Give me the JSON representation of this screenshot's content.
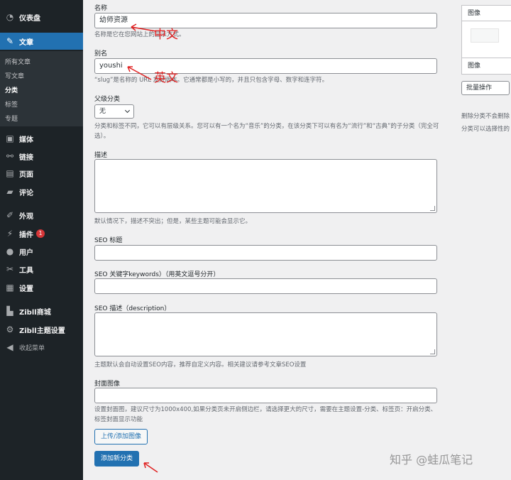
{
  "sidebar": {
    "dashboard": "仪表盘",
    "posts": "文章",
    "submenu": [
      "所有文章",
      "写文章",
      "分类",
      "标签",
      "专题"
    ],
    "media": "媒体",
    "links": "链接",
    "pages": "页面",
    "comments": "评论",
    "appearance": "外观",
    "plugins": "插件",
    "plugins_badge": "1",
    "users": "用户",
    "tools": "工具",
    "settings": "设置",
    "zibll_shop": "Zibll商城",
    "zibll_theme": "Zibll主题设置",
    "collapse": "收起菜单"
  },
  "form": {
    "name_label": "名称",
    "name_value": "幼师资源",
    "name_help": "名称是它在您网站上的显示方式。",
    "slug_label": "别名",
    "slug_value": "youshi",
    "slug_help": "“slug”是名称的 URL 友好版本。它通常都是小写的，并且只包含字母、数字和连字符。",
    "parent_label": "父级分类",
    "parent_value": "无",
    "parent_help": "分类和标签不同，它可以有层级关系。您可以有一个名为“音乐”的分类，在该分类下可以有名为“流行”和“古典”的子分类（完全可选）。",
    "desc_label": "描述",
    "desc_help": "默认情况下，描述不突出；但是，某些主题可能会显示它。",
    "seo_title_label": "SEO 标题",
    "seo_keywords_label": "SEO 关键字keywords）（用英文逗号分开）",
    "seo_desc_label": "SEO 描述（description）",
    "seo_desc_help": "主题默认会自动设置SEO内容，推荐自定义内容。相关建议请参考文章SEO设置",
    "cover_label": "封面图像",
    "cover_help": "设置封面图，建议尺寸为1000x400,如果分类页未开启侧边栏，请选择更大的尺寸，需要在主题设置-分类、标签页：开启分类、标签封面显示功能",
    "upload_button": "上传/添加图像",
    "submit_button": "添加新分类"
  },
  "annotations": {
    "chinese": "中文",
    "english": "英文"
  },
  "right_panel": {
    "image_header_top": "图像",
    "image_header_bottom": "图像",
    "bulk_action": "批量操作",
    "note_line1": "删除分类不会删除",
    "note_line2": "分类可以选择性的"
  },
  "watermark": "知乎 @蛙瓜笔记",
  "colors": {
    "sidebar_bg": "#1d2327",
    "accent": "#2271b1",
    "annotation": "#e02020",
    "badge": "#d63638"
  }
}
